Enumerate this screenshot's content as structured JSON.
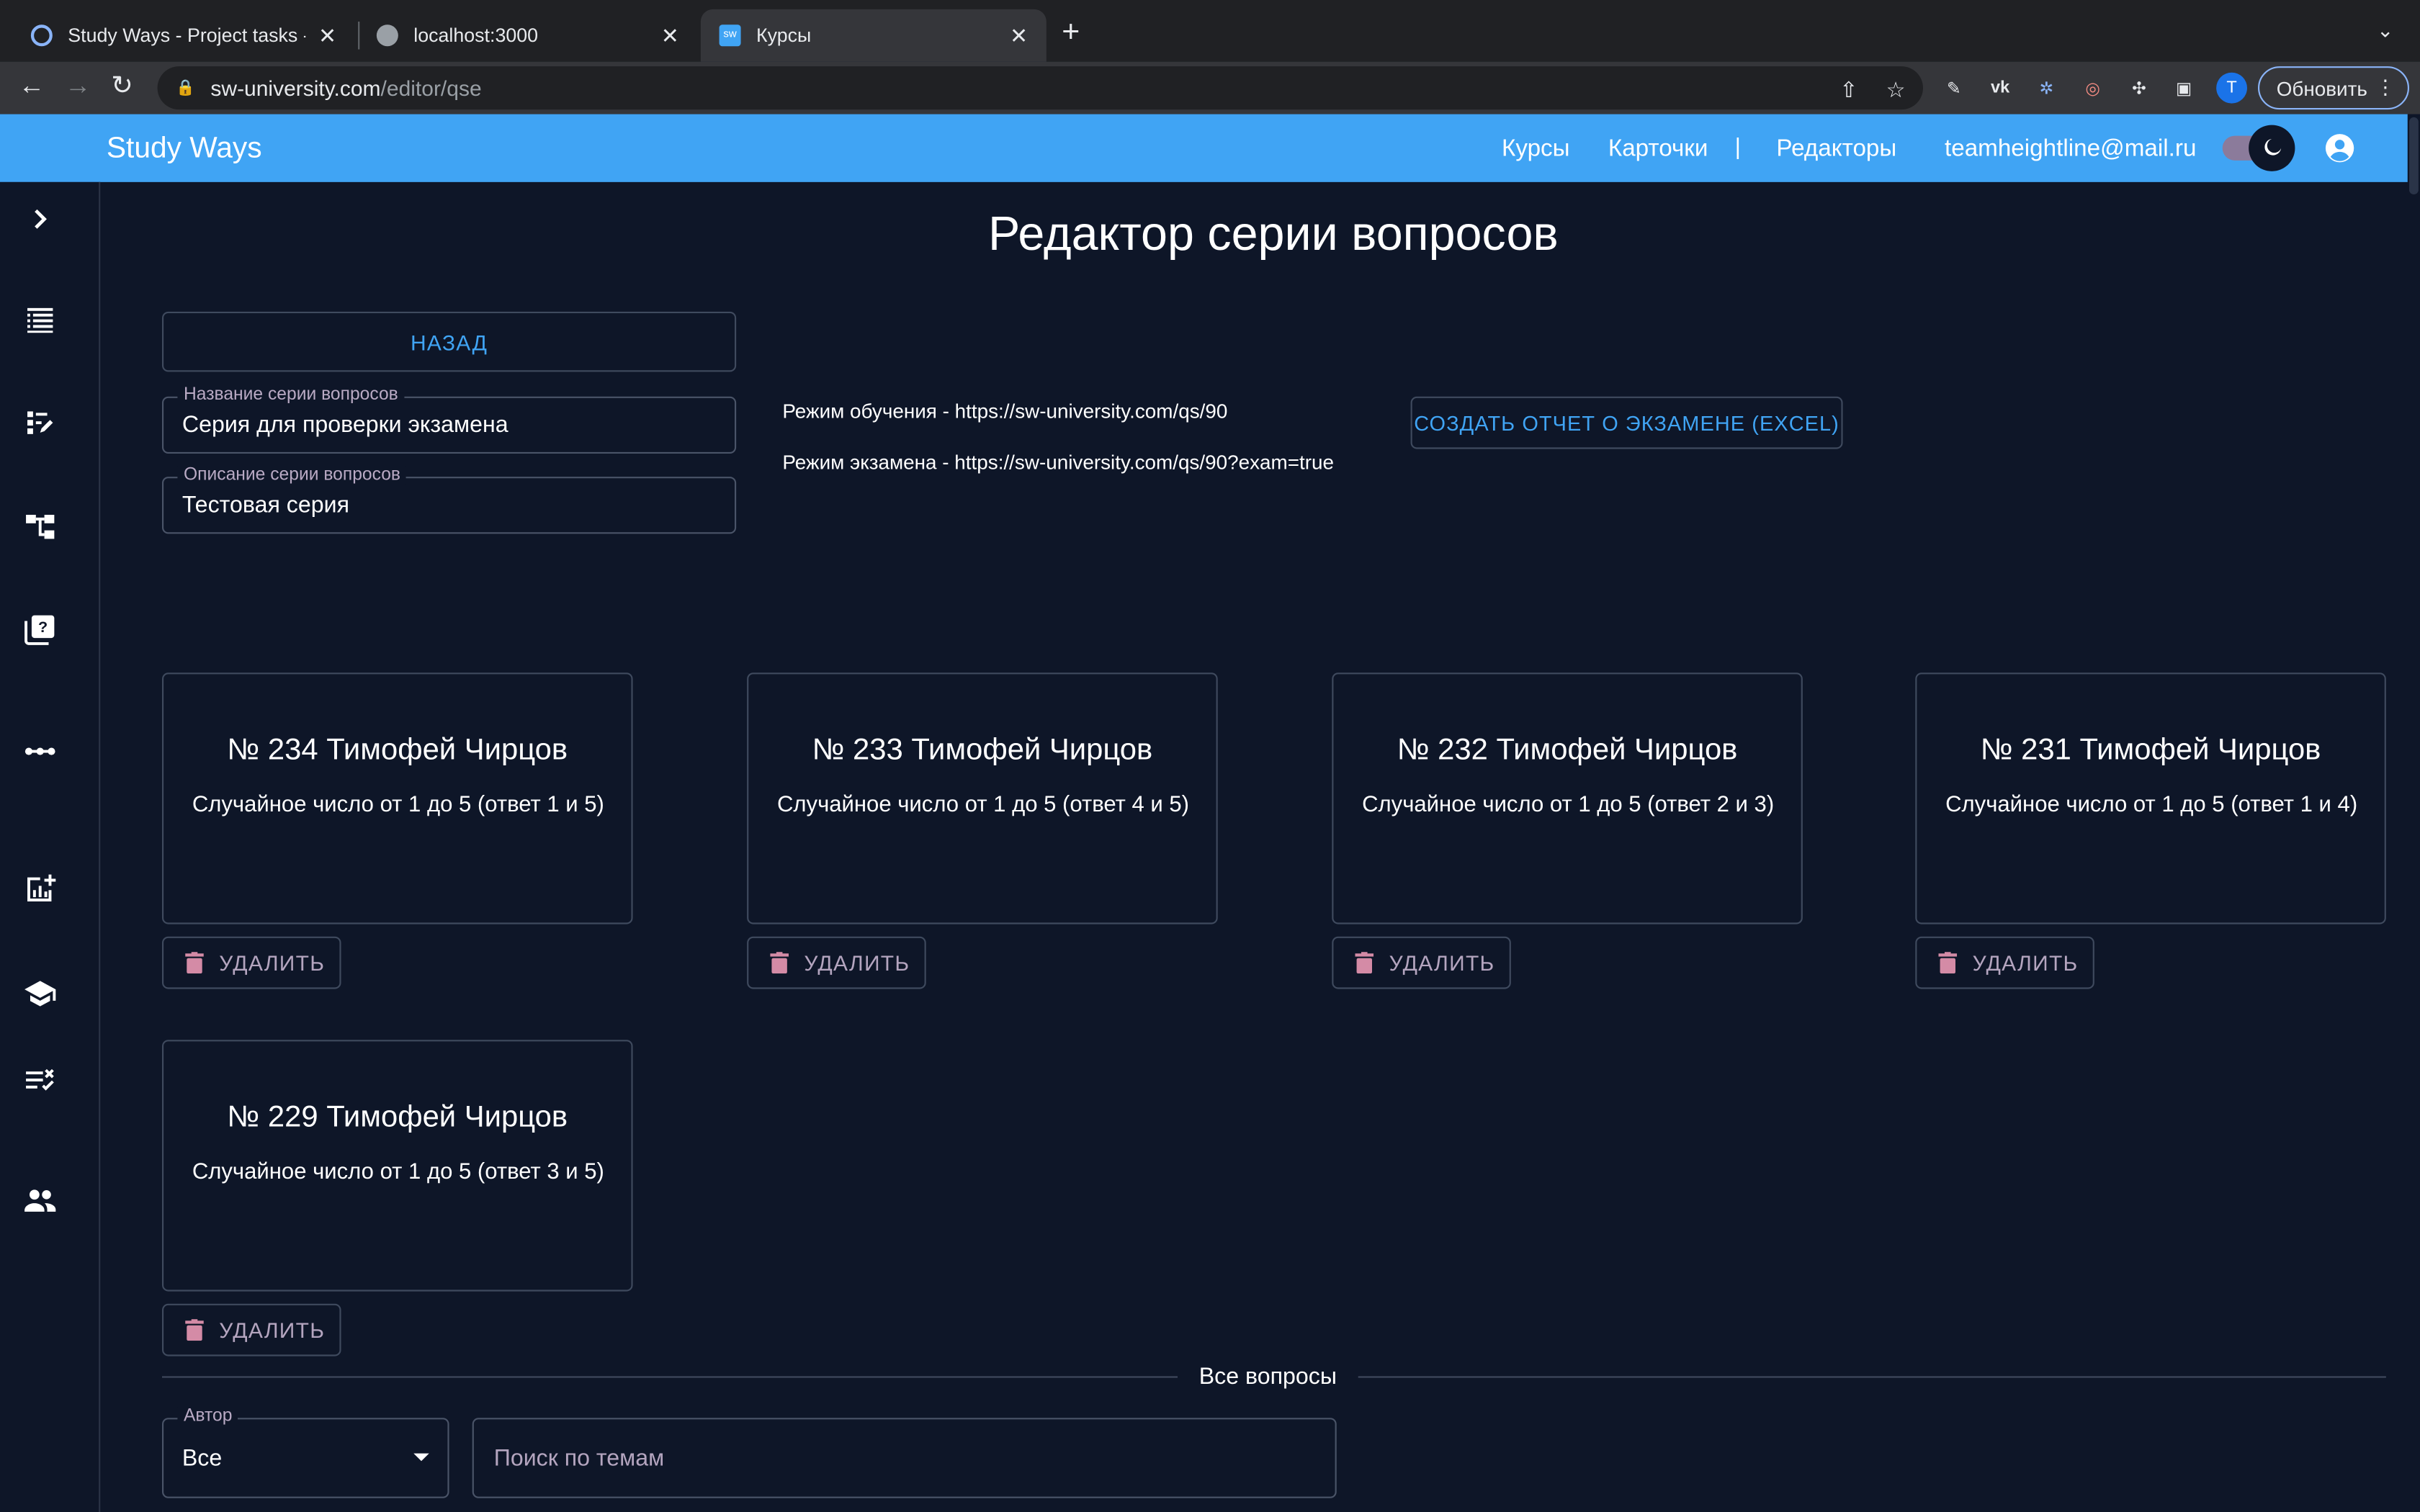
{
  "browser": {
    "tabs": [
      {
        "title": "Study Ways - Project tasks - W",
        "close": "✕"
      },
      {
        "title": "localhost:3000",
        "close": "✕"
      },
      {
        "title": "Курсы",
        "close": "✕"
      }
    ],
    "url_host": "sw-university.com",
    "url_path": "/editor/qse",
    "profile_initial": "T",
    "update_label": "Обновить"
  },
  "app": {
    "brand": "Study Ways",
    "nav": {
      "courses": "Курсы",
      "cards": "Карточки",
      "separator": "|",
      "editors": "Редакторы",
      "email": "teamheightline@mail.ru"
    },
    "accent_color": "#40a4f4",
    "background_color": "#0e1628"
  },
  "sidebar": {
    "icons": [
      "chevron-right-icon",
      "list-icon",
      "edit-note-icon",
      "tree-icon",
      "quiz-icon",
      "dots-line-icon",
      "add-chart-icon",
      "school-icon",
      "checklist-icon",
      "people-icon"
    ]
  },
  "editor": {
    "title": "Редактор серии вопросов",
    "back_label": "НАЗАД",
    "name_label": "Название серии вопросов",
    "name_value": "Серия для проверки экзамена",
    "description_label": "Описание серии вопросов",
    "description_value": "Тестовая серия",
    "learning_mode": "Режим обучения - https://sw-university.com/qs/90",
    "exam_mode": "Режим экзамена - https://sw-university.com/qs/90?exam=true",
    "report_label": "СОЗДАТЬ ОТЧЕТ О ЭКЗАМЕНЕ (EXCEL)"
  },
  "questions": [
    {
      "title": "№ 234 Тимофей Чирцов",
      "description": "Случайное число от 1 до 5 (ответ 1 и 5)",
      "delete_label": "УДАЛИТЬ"
    },
    {
      "title": "№ 233 Тимофей Чирцов",
      "description": "Случайное число от 1 до 5 (ответ 4 и 5)",
      "delete_label": "УДАЛИТЬ"
    },
    {
      "title": "№ 232 Тимофей Чирцов",
      "description": "Случайное число от 1 до 5 (ответ 2 и 3)",
      "delete_label": "УДАЛИТЬ"
    },
    {
      "title": "№ 231 Тимофей Чирцов",
      "description": "Случайное число от 1 до 5 (ответ 1 и 4)",
      "delete_label": "УДАЛИТЬ"
    },
    {
      "title": "№ 229 Тимофей Чирцов",
      "description": "Случайное число от 1 до 5 (ответ 3 и 5)",
      "delete_label": "УДАЛИТЬ"
    }
  ],
  "all_questions": {
    "divider_label": "Все вопросы",
    "author_label": "Автор",
    "author_value": "Все",
    "search_placeholder": "Поиск по темам"
  }
}
